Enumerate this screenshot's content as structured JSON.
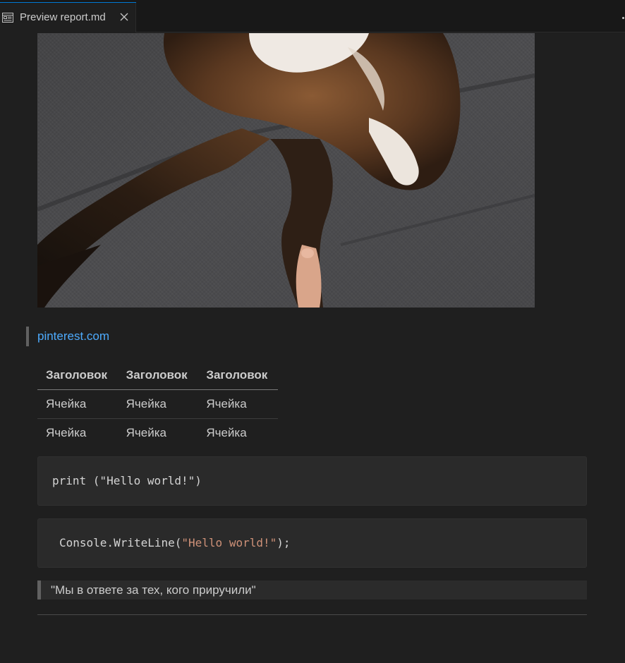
{
  "tab": {
    "title": "Preview report.md",
    "icon": "preview-icon",
    "close_icon": "close-icon"
  },
  "content": {
    "image_icon": "ferret-photo",
    "source_link": "pinterest.com",
    "table": {
      "headers": [
        "Заголовок",
        "Заголовок",
        "Заголовок"
      ],
      "rows": [
        [
          "Ячейка",
          "Ячейка",
          "Ячейка"
        ],
        [
          "Ячейка",
          "Ячейка",
          "Ячейка"
        ]
      ]
    },
    "code_block_1": {
      "line": "print (\"Hello world!\")"
    },
    "code_block_2": {
      "prefix": "Console.WriteLine(",
      "string": "\"Hello world!\"",
      "suffix": ");"
    },
    "blockquote": "\"Мы в ответе за тех, кого приручили\""
  },
  "colors": {
    "background": "#1f1f1f",
    "link": "#4daafc",
    "string": "#ce9178",
    "accent": "#0078d4"
  }
}
